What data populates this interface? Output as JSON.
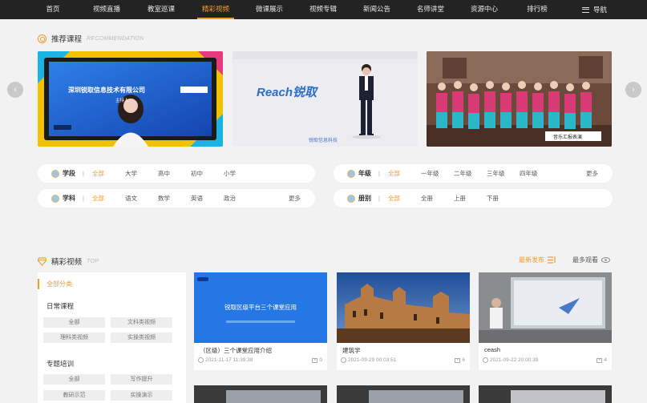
{
  "nav": {
    "items": [
      "首页",
      "视频直播",
      "教室巡课",
      "精彩视频",
      "微课展示",
      "视频专辑",
      "新闻公告",
      "名师讲堂",
      "资源中心",
      "排行榜"
    ],
    "active_index": 3,
    "menu_label": "导航"
  },
  "recommend": {
    "title": "推荐课程",
    "subtitle": "RECOMMENDATION",
    "slides": [
      {
        "banner_text": "深圳锐取信息技术有限公司",
        "sub_text": "主持人",
        "caption": ""
      },
      {
        "logo_text": "Reach锐取",
        "caption": "锐取信息科技"
      },
      {
        "caption": "音乐汇报表演"
      }
    ]
  },
  "filters": {
    "duan": {
      "label": "学段",
      "options": [
        "全部",
        "大学",
        "高中",
        "初中",
        "小学"
      ],
      "selected": 0
    },
    "nianji": {
      "label": "年级",
      "options": [
        "全部",
        "一年级",
        "二年级",
        "三年级",
        "四年级"
      ],
      "selected": 0,
      "more": "更多"
    },
    "xueke": {
      "label": "学科",
      "options": [
        "全部",
        "语文",
        "数学",
        "英语",
        "政治"
      ],
      "selected": 0,
      "more": "更多"
    },
    "cebie": {
      "label": "册别",
      "options": [
        "全部",
        "全册",
        "上册",
        "下册"
      ],
      "selected": 0
    }
  },
  "featured": {
    "title": "精彩视频",
    "subtitle": "TOP",
    "sort_latest": "最新发布",
    "sort_most": "最多观看"
  },
  "sidebar": {
    "all_label": "全部分类",
    "groups": [
      {
        "name": "日常课程",
        "tags": [
          "全部",
          "文科类视频",
          "理科类视频",
          "实操类视频"
        ]
      },
      {
        "name": "专题培训",
        "tags": [
          "全部",
          "写作提升",
          "教研示范",
          "实操演示"
        ]
      }
    ]
  },
  "videos": [
    {
      "title": "（区级）三个课堂应用介绍",
      "date": "2021-11-17 11:39:38",
      "count": "0",
      "thumb_text": "锐取区级平台三个课堂应用"
    },
    {
      "title": "建筑学",
      "date": "2021-09-29 00:03:51",
      "count": "6"
    },
    {
      "title": "ceash",
      "date": "2021-09-22 20:00:39",
      "count": "4"
    }
  ],
  "colors": {
    "accent": "#f39a2b",
    "nav_bg": "#232323",
    "page_bg": "#f2f2f2"
  }
}
